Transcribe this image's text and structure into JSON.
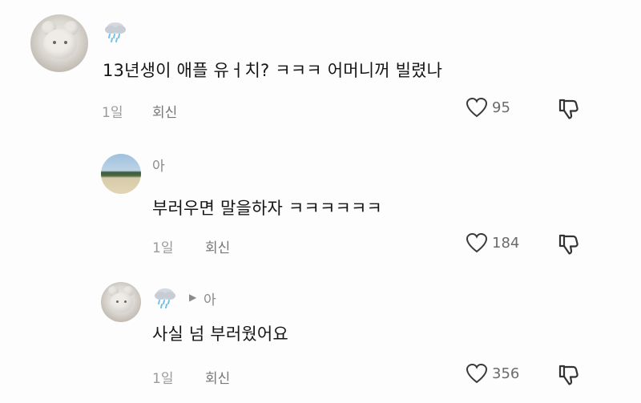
{
  "comments": [
    {
      "user": "",
      "text": "13년생이 애플 유ㅓ치? ㅋㅋㅋ 어머니꺼 빌렸나",
      "time": "1일",
      "reply_label": "회신",
      "likes": "95",
      "avatar_icon": "plush-toy-avatar",
      "user_icon": "rain-cloud-icon"
    },
    {
      "user": "아",
      "text": "부러우면 말을하자 ㅋㅋㅋㅋㅋㅋ",
      "time": "1일",
      "reply_label": "회신",
      "likes": "184",
      "avatar_icon": "landscape-avatar"
    },
    {
      "user": "",
      "reply_to": "아",
      "text": "사실 넘 부러웠어요",
      "time": "1일",
      "reply_label": "회신",
      "likes": "356",
      "avatar_icon": "plush-toy-avatar",
      "user_icon": "rain-cloud-icon"
    }
  ],
  "colors": {
    "background": "#fdfdfd",
    "text": "#161616",
    "muted": "#9a9a9a",
    "rain": "#6fc3e8"
  }
}
